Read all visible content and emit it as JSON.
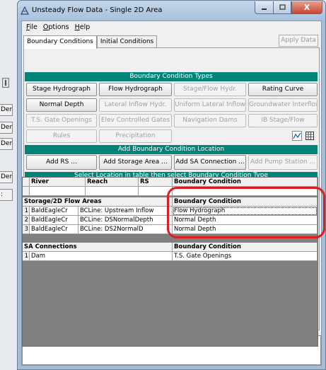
{
  "left_panel": {
    "stub_label": "Der",
    "stub_label_small": ":"
  },
  "window": {
    "title": "Unsteady Flow Data - Single 2D Area",
    "close_glyph": "X"
  },
  "menu": [
    {
      "label_u": "F",
      "label_rest": "ile"
    },
    {
      "label_u": "O",
      "label_rest": "ptions"
    },
    {
      "label_u": "H",
      "label_rest": "elp"
    }
  ],
  "tabs": [
    "Boundary Conditions",
    "Initial Conditions"
  ],
  "apply_label": "Apply Data",
  "bc_types": {
    "heading": "Boundary Condition Types",
    "row1": [
      "Stage Hydrograph",
      "Flow Hydrograph",
      "Stage/Flow Hydr.",
      "Rating Curve"
    ],
    "row2": [
      "Normal Depth",
      "Lateral Inflow Hydr.",
      "Uniform Lateral Inflow",
      "Groundwater Interflow"
    ],
    "row3": [
      "T.S. Gate Openings",
      "Elev Controlled Gates",
      "Navigation Dams",
      "IB Stage/Flow"
    ],
    "row4": [
      "Rules",
      "Precipitation"
    ]
  },
  "add_location": {
    "heading": "Add Boundary Condition Location",
    "buttons": [
      "Add RS ...",
      "Add Storage Area ...",
      "Add SA Connection ...",
      "Add Pump Station ..."
    ]
  },
  "table_heading": "Select Location in table then select Boundary Condition Type",
  "river_table": {
    "columns": [
      "River",
      "Reach",
      "RS",
      "Boundary Condition"
    ]
  },
  "storage_table": {
    "header_left": "Storage/2D Flow Areas",
    "header_right": "Boundary Condition",
    "rows": [
      {
        "num": "1",
        "area": "BaldEagleCr",
        "line": "BCLine: Upstream Inflow",
        "bc": "Flow Hydrograph"
      },
      {
        "num": "2",
        "area": "BaldEagleCr",
        "line": "BCLine: DSNormalDepth",
        "bc": "Normal Depth"
      },
      {
        "num": "3",
        "area": "BaldEagleCr",
        "line": "BCLine: DS2NormalD",
        "bc": "Normal Depth"
      }
    ]
  },
  "sa_table": {
    "header_left": "SA Connections",
    "header_right": "Boundary Condition",
    "rows": [
      {
        "num": "1",
        "name": "Dam",
        "bc": "T.S. Gate Openings"
      }
    ]
  }
}
